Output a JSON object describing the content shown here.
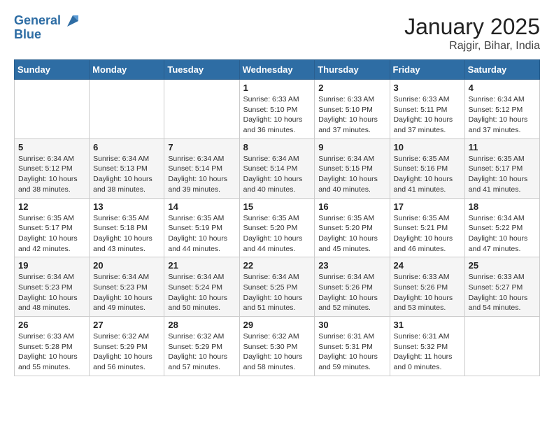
{
  "header": {
    "logo_line1": "General",
    "logo_line2": "Blue",
    "month_title": "January 2025",
    "location": "Rajgir, Bihar, India"
  },
  "weekdays": [
    "Sunday",
    "Monday",
    "Tuesday",
    "Wednesday",
    "Thursday",
    "Friday",
    "Saturday"
  ],
  "weeks": [
    [
      {
        "day": "",
        "info": ""
      },
      {
        "day": "",
        "info": ""
      },
      {
        "day": "",
        "info": ""
      },
      {
        "day": "1",
        "info": "Sunrise: 6:33 AM\nSunset: 5:10 PM\nDaylight: 10 hours\nand 36 minutes."
      },
      {
        "day": "2",
        "info": "Sunrise: 6:33 AM\nSunset: 5:10 PM\nDaylight: 10 hours\nand 37 minutes."
      },
      {
        "day": "3",
        "info": "Sunrise: 6:33 AM\nSunset: 5:11 PM\nDaylight: 10 hours\nand 37 minutes."
      },
      {
        "day": "4",
        "info": "Sunrise: 6:34 AM\nSunset: 5:12 PM\nDaylight: 10 hours\nand 37 minutes."
      }
    ],
    [
      {
        "day": "5",
        "info": "Sunrise: 6:34 AM\nSunset: 5:12 PM\nDaylight: 10 hours\nand 38 minutes."
      },
      {
        "day": "6",
        "info": "Sunrise: 6:34 AM\nSunset: 5:13 PM\nDaylight: 10 hours\nand 38 minutes."
      },
      {
        "day": "7",
        "info": "Sunrise: 6:34 AM\nSunset: 5:14 PM\nDaylight: 10 hours\nand 39 minutes."
      },
      {
        "day": "8",
        "info": "Sunrise: 6:34 AM\nSunset: 5:14 PM\nDaylight: 10 hours\nand 40 minutes."
      },
      {
        "day": "9",
        "info": "Sunrise: 6:34 AM\nSunset: 5:15 PM\nDaylight: 10 hours\nand 40 minutes."
      },
      {
        "day": "10",
        "info": "Sunrise: 6:35 AM\nSunset: 5:16 PM\nDaylight: 10 hours\nand 41 minutes."
      },
      {
        "day": "11",
        "info": "Sunrise: 6:35 AM\nSunset: 5:17 PM\nDaylight: 10 hours\nand 41 minutes."
      }
    ],
    [
      {
        "day": "12",
        "info": "Sunrise: 6:35 AM\nSunset: 5:17 PM\nDaylight: 10 hours\nand 42 minutes."
      },
      {
        "day": "13",
        "info": "Sunrise: 6:35 AM\nSunset: 5:18 PM\nDaylight: 10 hours\nand 43 minutes."
      },
      {
        "day": "14",
        "info": "Sunrise: 6:35 AM\nSunset: 5:19 PM\nDaylight: 10 hours\nand 44 minutes."
      },
      {
        "day": "15",
        "info": "Sunrise: 6:35 AM\nSunset: 5:20 PM\nDaylight: 10 hours\nand 44 minutes."
      },
      {
        "day": "16",
        "info": "Sunrise: 6:35 AM\nSunset: 5:20 PM\nDaylight: 10 hours\nand 45 minutes."
      },
      {
        "day": "17",
        "info": "Sunrise: 6:35 AM\nSunset: 5:21 PM\nDaylight: 10 hours\nand 46 minutes."
      },
      {
        "day": "18",
        "info": "Sunrise: 6:34 AM\nSunset: 5:22 PM\nDaylight: 10 hours\nand 47 minutes."
      }
    ],
    [
      {
        "day": "19",
        "info": "Sunrise: 6:34 AM\nSunset: 5:23 PM\nDaylight: 10 hours\nand 48 minutes."
      },
      {
        "day": "20",
        "info": "Sunrise: 6:34 AM\nSunset: 5:23 PM\nDaylight: 10 hours\nand 49 minutes."
      },
      {
        "day": "21",
        "info": "Sunrise: 6:34 AM\nSunset: 5:24 PM\nDaylight: 10 hours\nand 50 minutes."
      },
      {
        "day": "22",
        "info": "Sunrise: 6:34 AM\nSunset: 5:25 PM\nDaylight: 10 hours\nand 51 minutes."
      },
      {
        "day": "23",
        "info": "Sunrise: 6:34 AM\nSunset: 5:26 PM\nDaylight: 10 hours\nand 52 minutes."
      },
      {
        "day": "24",
        "info": "Sunrise: 6:33 AM\nSunset: 5:26 PM\nDaylight: 10 hours\nand 53 minutes."
      },
      {
        "day": "25",
        "info": "Sunrise: 6:33 AM\nSunset: 5:27 PM\nDaylight: 10 hours\nand 54 minutes."
      }
    ],
    [
      {
        "day": "26",
        "info": "Sunrise: 6:33 AM\nSunset: 5:28 PM\nDaylight: 10 hours\nand 55 minutes."
      },
      {
        "day": "27",
        "info": "Sunrise: 6:32 AM\nSunset: 5:29 PM\nDaylight: 10 hours\nand 56 minutes."
      },
      {
        "day": "28",
        "info": "Sunrise: 6:32 AM\nSunset: 5:29 PM\nDaylight: 10 hours\nand 57 minutes."
      },
      {
        "day": "29",
        "info": "Sunrise: 6:32 AM\nSunset: 5:30 PM\nDaylight: 10 hours\nand 58 minutes."
      },
      {
        "day": "30",
        "info": "Sunrise: 6:31 AM\nSunset: 5:31 PM\nDaylight: 10 hours\nand 59 minutes."
      },
      {
        "day": "31",
        "info": "Sunrise: 6:31 AM\nSunset: 5:32 PM\nDaylight: 11 hours\nand 0 minutes."
      },
      {
        "day": "",
        "info": ""
      }
    ]
  ]
}
